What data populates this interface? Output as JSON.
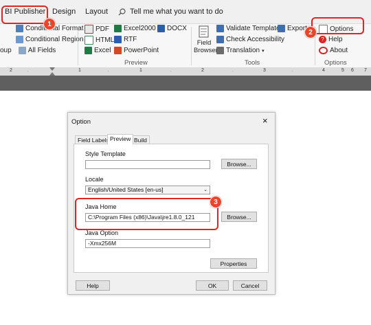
{
  "ribbon_tabs": [
    "BI Publisher",
    "Design",
    "Layout"
  ],
  "tell_me": "Tell me what you want to do",
  "left_cut_items": {
    "conditional_format": "Conditional Format",
    "conditional_region": "Conditional Region",
    "group_cut": "oup",
    "all_fields": "All Fields"
  },
  "preview_group": {
    "pdf": "PDF",
    "html": "HTML",
    "excel": "Excel",
    "excel2000": "Excel2000",
    "rtf": "RTF",
    "powerpoint": "PowerPoint",
    "docx": "DOCX",
    "label": "Preview"
  },
  "tools_group": {
    "field_browser": "Field Browser",
    "validate_template": "Validate Template",
    "check_accessibility": "Check Accessibility",
    "translation": "Translation",
    "export": "Export",
    "label": "Tools"
  },
  "options_group": {
    "options": "Options",
    "help": "Help",
    "about": "About",
    "label": "Options"
  },
  "ruler_numbers": [
    "2",
    "1",
    "1",
    "2",
    "3",
    "4",
    "5",
    "6",
    "7"
  ],
  "badges": [
    "1",
    "2",
    "3"
  ],
  "dialog": {
    "title": "Option",
    "close": "×",
    "tabs": [
      "Field Labels",
      "Preview",
      "Build"
    ],
    "style_template_label": "Style Template",
    "style_template_value": "",
    "browse1": "Browse...",
    "locale_label": "Locale",
    "locale_value": "English/United States [en-us]",
    "java_home_label": "Java Home",
    "java_home_value": "C:\\Program Files (x86)\\Java\\jre1.8.0_121",
    "browse2": "Browse...",
    "java_option_label": "Java Option",
    "java_option_value": "-Xmx256M",
    "properties": "Properties",
    "help": "Help",
    "ok": "OK",
    "cancel": "Cancel"
  },
  "colors": {
    "callout_red": "#e02424",
    "badge_red": "#e8452b",
    "ruler_gray": "#dcdcdc",
    "dark_gray": "#5f5f5f"
  }
}
